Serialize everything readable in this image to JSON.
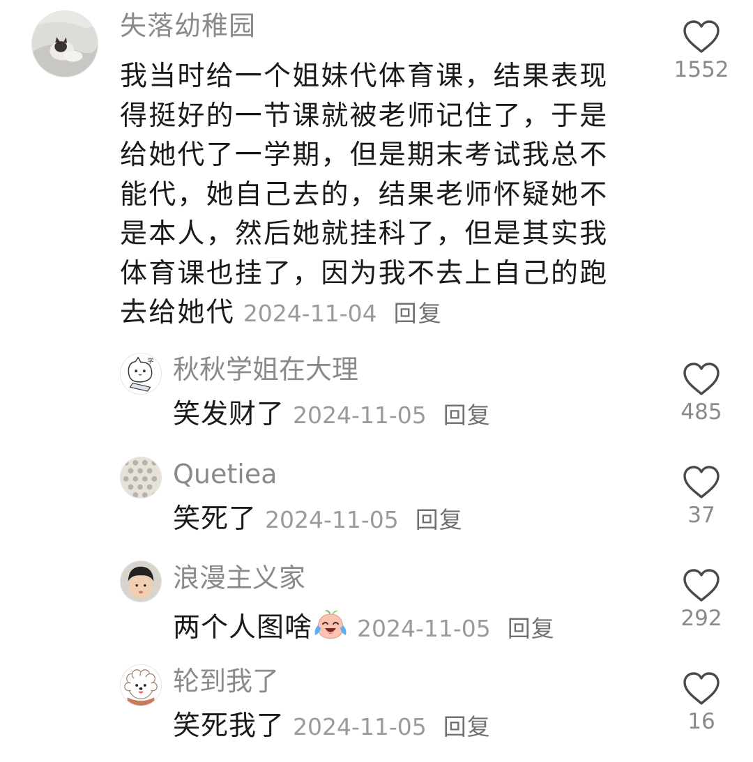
{
  "comment": {
    "username": "失落幼稚园",
    "avatar_icon": "cat-photo-avatar",
    "text": "我当时给一个姐妹代体育课，结果表现得挺好的一节课就被老师记住了，于是给她代了一学期，但是期末考试我总不能代，她自己去的，结果老师怀疑她不是本人，然后她就挂科了，但是其实我体育课也挂了，因为我不去上自己的跑去给她代",
    "date": "2024-11-04",
    "reply_label": "回复",
    "like_count": "1552"
  },
  "replies": [
    {
      "username": "秋秋学姐在大理",
      "avatar_icon": "cartoon-cat-avatar",
      "text": "笑发财了",
      "date": "2024-11-05",
      "reply_label": "回复",
      "like_count": "485"
    },
    {
      "username": "Quetiea",
      "avatar_icon": "pattern-avatar",
      "text": "笑死了",
      "date": "2024-11-05",
      "reply_label": "回复",
      "like_count": "37"
    },
    {
      "username": "浪漫主义家",
      "avatar_icon": "child-photo-avatar",
      "text": "两个人图啥",
      "emoji": "crying-laughing-peach-emoji",
      "date": "2024-11-05",
      "reply_label": "回复",
      "like_count": "292"
    },
    {
      "username": "轮到我了",
      "avatar_icon": "white-dog-avatar",
      "text": "笑死我了",
      "date": "2024-11-05",
      "reply_label": "回复",
      "like_count": "16"
    }
  ],
  "colors": {
    "name": "#8a8a8a",
    "text": "#1a1a1a",
    "meta": "#9a9a9a",
    "heart_outline": "#4a4a4a"
  }
}
